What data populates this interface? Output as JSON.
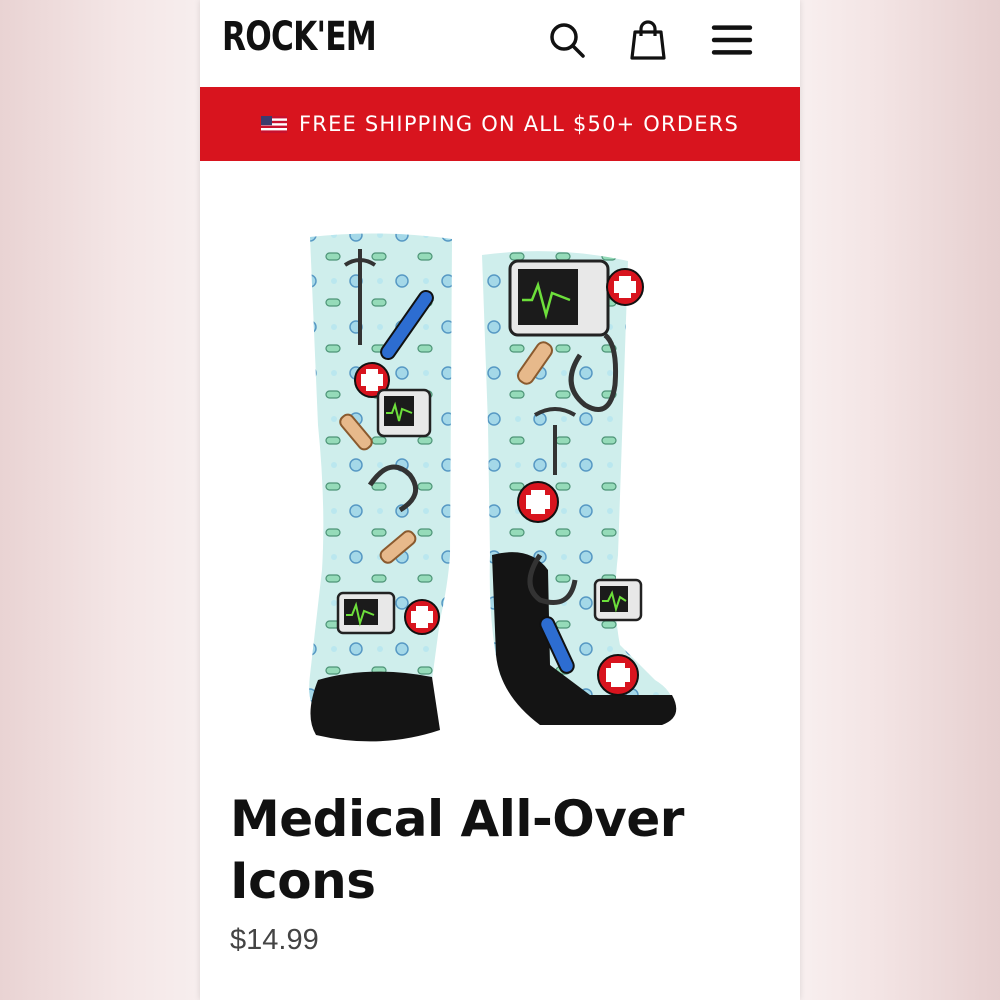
{
  "header": {
    "logo": "ROCK'EM",
    "search_icon": "search-icon",
    "cart_icon": "shopping-bag-icon",
    "menu_icon": "hamburger-menu-icon"
  },
  "banner": {
    "flag_icon": "us-flag-icon",
    "text": "FREE SHIPPING ON ALL $50+ ORDERS",
    "background": "#d8141e"
  },
  "product": {
    "title": "Medical All-Over Icons",
    "price": "$14.99",
    "image_colors": {
      "sock": "#cfeeec",
      "toe_heel": "#141414",
      "accent_red": "#d8141e"
    }
  }
}
